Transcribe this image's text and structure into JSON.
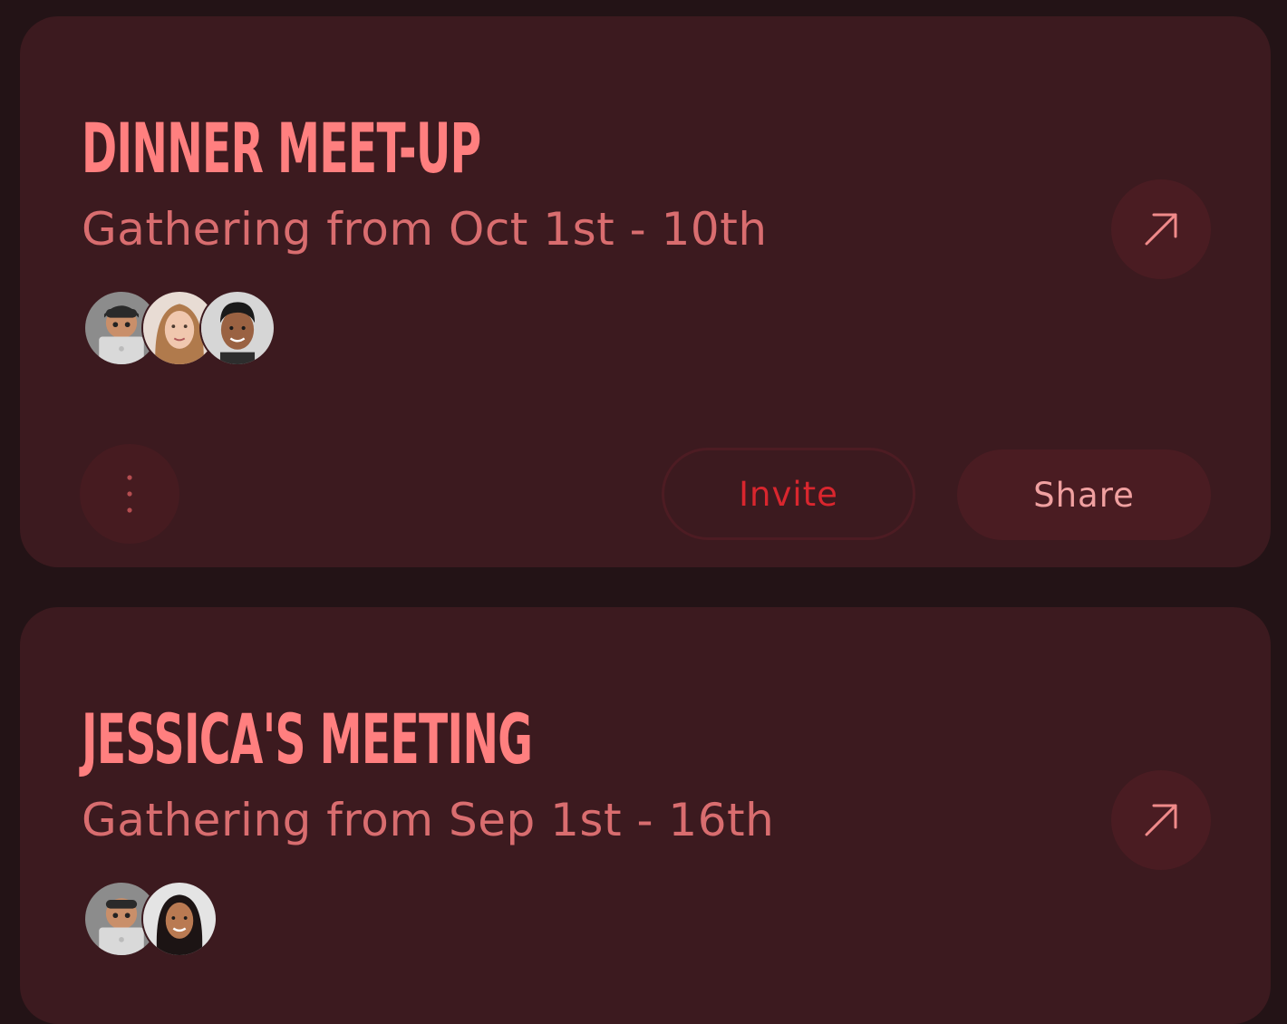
{
  "events": [
    {
      "title": "DINNER MEET-UP",
      "subtitle": "Gathering from Oct 1st - 10th",
      "open_icon": "arrow-up-right-icon",
      "attendees": [
        {
          "avatar": "memoji-laptop-avatar"
        },
        {
          "avatar": "woman-blonde-avatar"
        },
        {
          "avatar": "man-dark-hair-avatar"
        }
      ],
      "more_icon": "vertical-dots-icon",
      "invite_label": "Invite",
      "share_label": "Share"
    },
    {
      "title": "JESSICA'S MEETING",
      "subtitle": "Gathering from Sep 1st - 16th",
      "open_icon": "arrow-up-right-icon",
      "attendees": [
        {
          "avatar": "memoji-laptop-avatar"
        },
        {
          "avatar": "woman-dark-hair-avatar"
        }
      ]
    }
  ],
  "colors": {
    "background": "#231316",
    "card": "#3c1a1f",
    "title": "#ff7f7f",
    "subtitle": "#d96d6f",
    "invite_text": "#d9262e",
    "share_text": "#f0a0a0",
    "button_bg": "#4a1c22"
  }
}
